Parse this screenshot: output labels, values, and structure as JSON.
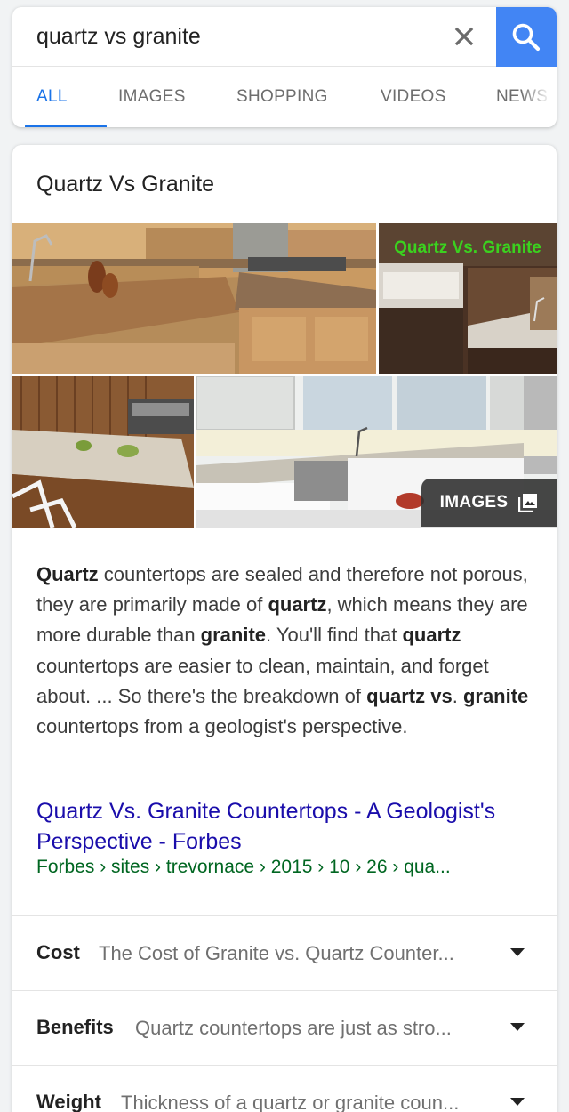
{
  "search": {
    "query": "quartz vs granite",
    "clear_icon": "close-icon",
    "search_icon": "search-icon",
    "accent_color": "#4285f4"
  },
  "tabs": [
    {
      "label": "ALL",
      "active": true
    },
    {
      "label": "IMAGES",
      "active": false
    },
    {
      "label": "SHOPPING",
      "active": false
    },
    {
      "label": "VIDEOS",
      "active": false
    },
    {
      "label": "NEWS",
      "active": false
    }
  ],
  "result": {
    "title": "Quartz Vs Granite",
    "image_overlay_text": "Quartz Vs. Granite",
    "images_button_label": "IMAGES",
    "snippet_parts": [
      {
        "text": "Quartz",
        "bold": true
      },
      {
        "text": " countertops are sealed and therefore not porous, they are primarily made of ",
        "bold": false
      },
      {
        "text": "quartz",
        "bold": true
      },
      {
        "text": ", which means they are more durable than ",
        "bold": false
      },
      {
        "text": "granite",
        "bold": true
      },
      {
        "text": ". You'll find that ",
        "bold": false
      },
      {
        "text": "quartz",
        "bold": true
      },
      {
        "text": " countertops are easier to clean, maintain, and forget about. ... So there's the breakdown of ",
        "bold": false
      },
      {
        "text": "quartz vs",
        "bold": true
      },
      {
        "text": ". ",
        "bold": false
      },
      {
        "text": "granite",
        "bold": true
      },
      {
        "text": " countertops from a geologist's perspective.",
        "bold": false
      }
    ],
    "link_title": "Quartz Vs. Granite Countertops - A Geologist's Perspective - Forbes",
    "link_url": "Forbes › sites › trevornace › 2015 › 10 › 26 › qua...",
    "link_color": "#1a0dab",
    "url_color": "#006621"
  },
  "accordion": [
    {
      "label": "Cost",
      "text": "The Cost of Granite vs. Quartz Counter..."
    },
    {
      "label": "Benefits",
      "text": "Quartz countertops are just as stro..."
    },
    {
      "label": "Weight",
      "text": "Thickness of a quartz or granite coun..."
    }
  ]
}
